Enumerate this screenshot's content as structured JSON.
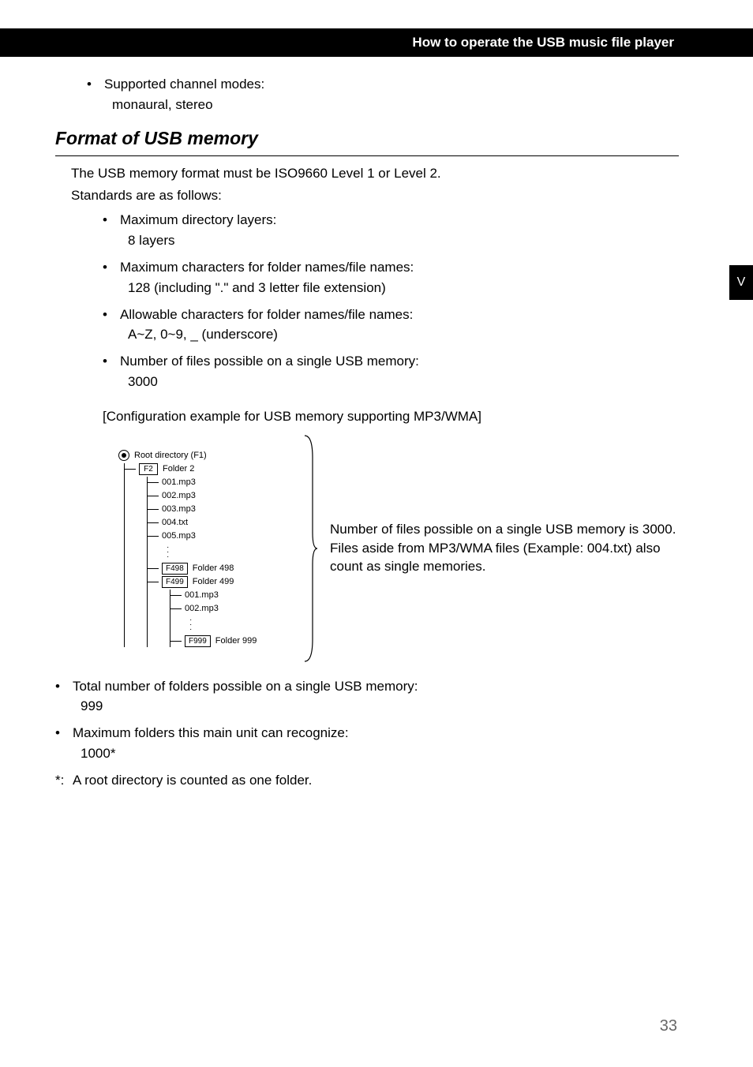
{
  "header": {
    "title": "How to operate the USB music file player"
  },
  "sideTab": "V",
  "topBullets": [
    {
      "label": "Supported channel modes:",
      "sub": "monaural, stereo"
    }
  ],
  "section": {
    "title": "Format of USB memory",
    "intro1": "The USB memory format must be ISO9660 Level 1 or Level 2.",
    "intro2": "Standards are as follows:",
    "bullets": [
      {
        "label": "Maximum directory layers:",
        "sub": "8 layers"
      },
      {
        "label": "Maximum characters for folder names/file names:",
        "sub": "128 (including \".\" and 3 letter file extension)"
      },
      {
        "label": "Allowable characters for folder names/file names:",
        "sub": "A~Z, 0~9, _ (underscore)"
      },
      {
        "label": "Number of files possible on a single USB memory:",
        "sub": "3000"
      }
    ],
    "configCaption": "[Configuration example for USB memory supporting MP3/WMA]"
  },
  "diagram": {
    "root": "Root directory (F1)",
    "f2box": "F2",
    "f2label": "Folder 2",
    "files_l2": [
      "001.mp3",
      "002.mp3",
      "003.mp3",
      "004.txt",
      "005.mp3"
    ],
    "f498box": "F498",
    "f498label": "Folder 498",
    "f499box": "F499",
    "f499label": "Folder 499",
    "files_l3": [
      "001.mp3",
      "002.mp3"
    ],
    "f999box": "F999",
    "f999label": "Folder 999",
    "note": "Number of files possible on a single USB memory is 3000. Files aside from MP3/WMA files (Example: 004.txt) also count as single memories."
  },
  "bottomBullets": [
    {
      "label": "Total number of folders possible on a single USB memory:",
      "sub": "999"
    },
    {
      "label": "Maximum folders this main unit can recognize:",
      "sub": "1000*"
    }
  ],
  "footnote": {
    "key": "*:",
    "text": "A root directory is counted as one folder."
  },
  "pageNumber": "33"
}
